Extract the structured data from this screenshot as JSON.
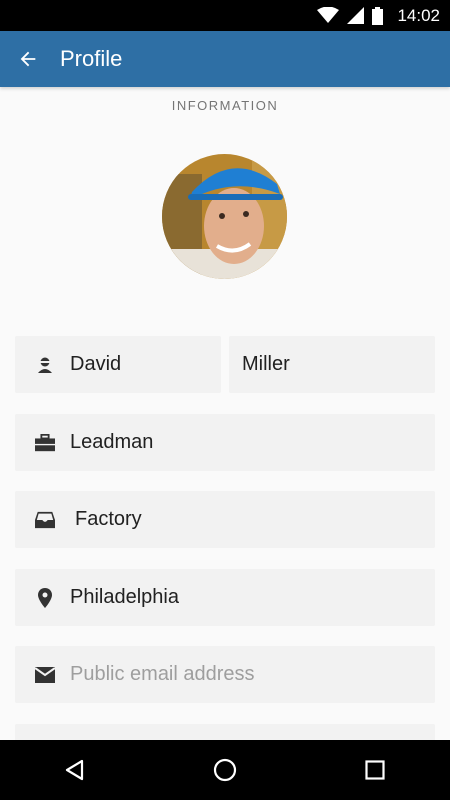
{
  "status_bar": {
    "time": "14:02",
    "icons": [
      "wifi-icon",
      "signal-icon",
      "battery-icon"
    ]
  },
  "app_bar": {
    "title": "Profile",
    "back_icon": "arrow-back-icon",
    "color": "#2e6fa5"
  },
  "section": {
    "header": "INFORMATION"
  },
  "profile": {
    "first_name": "David",
    "last_name": "Miller",
    "job_title": "Leadman",
    "department": "Factory",
    "location": "Philadelphia",
    "email_placeholder": "Public email address"
  },
  "nav_bar": {
    "buttons": [
      "back-triangle-icon",
      "home-circle-icon",
      "recents-square-icon"
    ]
  }
}
